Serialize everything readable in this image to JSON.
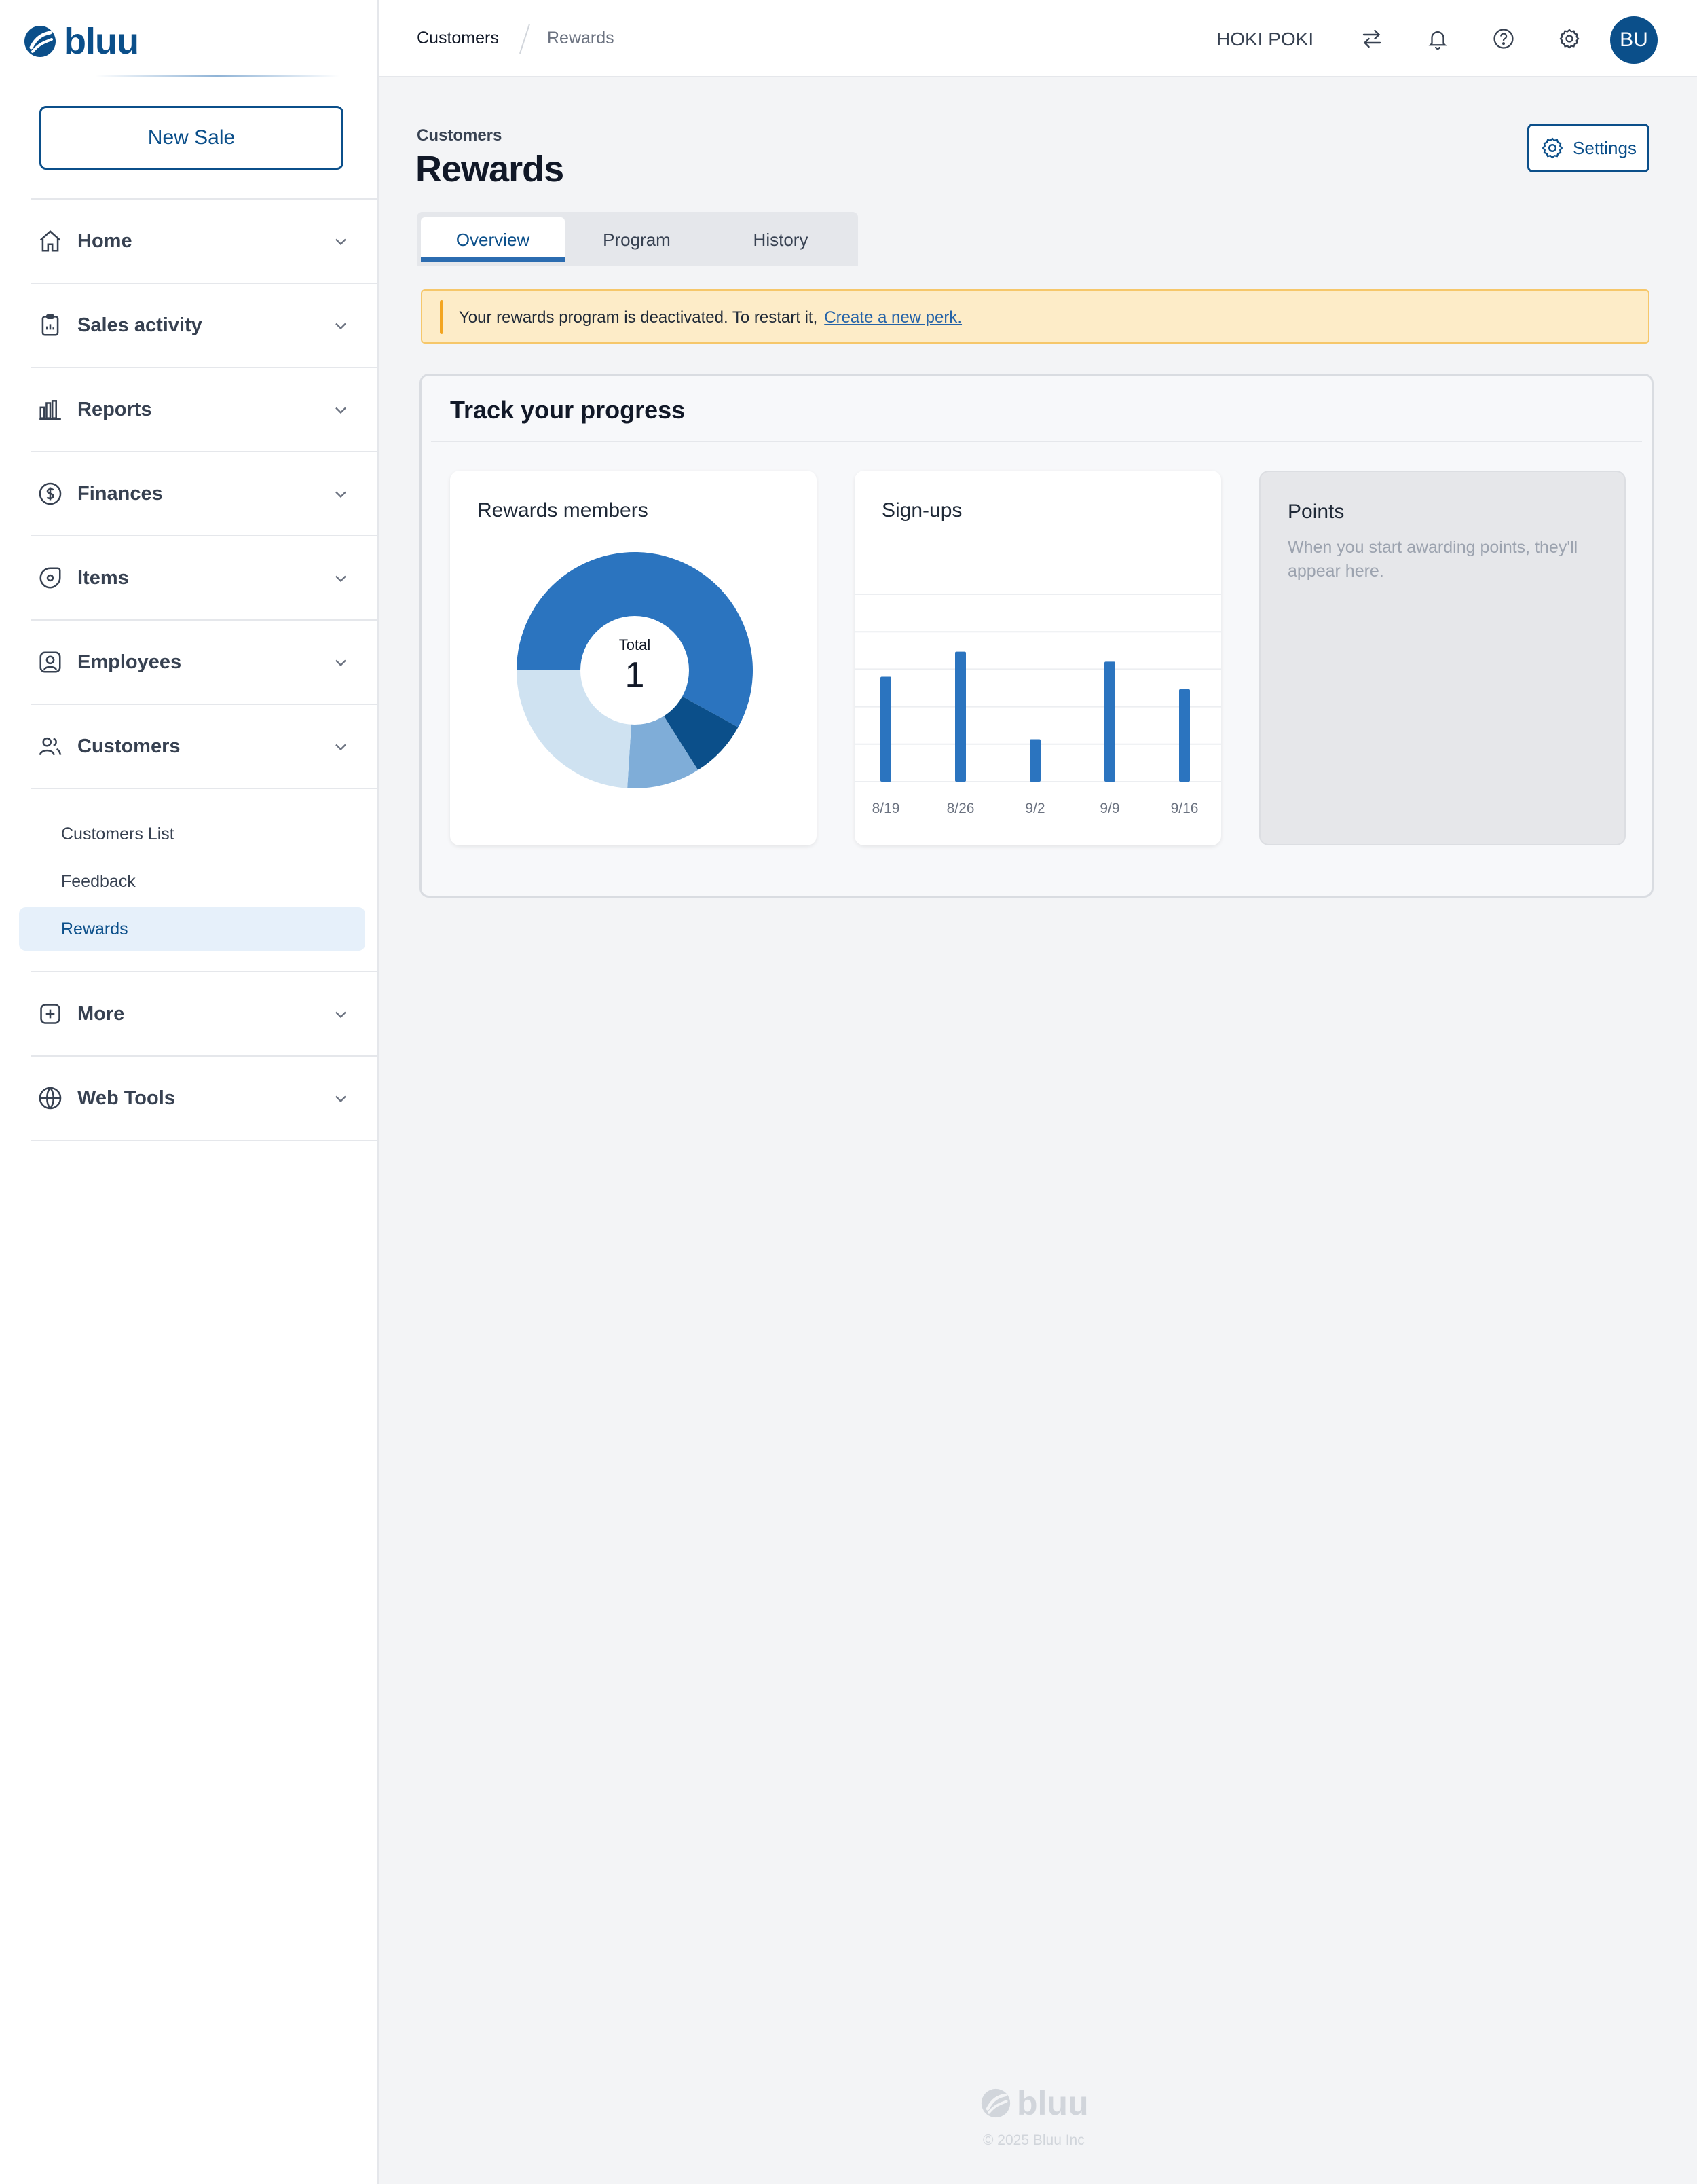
{
  "brand": {
    "name": "bluu",
    "accent": "#0b4f8a",
    "accent_light": "#2b6cb0"
  },
  "sidebar": {
    "new_sale_label": "New Sale",
    "items": [
      {
        "label": "Home",
        "icon": "home-icon"
      },
      {
        "label": "Sales activity",
        "icon": "clipboard-icon"
      },
      {
        "label": "Reports",
        "icon": "bar-chart-icon"
      },
      {
        "label": "Finances",
        "icon": "dollar-circle-icon"
      },
      {
        "label": "Items",
        "icon": "tag-icon"
      },
      {
        "label": "Employees",
        "icon": "id-badge-icon"
      },
      {
        "label": "Customers",
        "icon": "users-icon"
      },
      {
        "label": "More",
        "icon": "plus-square-icon"
      },
      {
        "label": "Web Tools",
        "icon": "globe-icon"
      }
    ],
    "customers_sub": [
      {
        "label": "Customers List",
        "active": false
      },
      {
        "label": "Feedback",
        "active": false
      },
      {
        "label": "Rewards",
        "active": true
      }
    ]
  },
  "topbar": {
    "breadcrumb": [
      "Customers",
      "Rewards"
    ],
    "store_name": "HOKI POKI",
    "icons": [
      "switch-arrows-icon",
      "bell-icon",
      "help-circle-icon",
      "gear-icon"
    ],
    "avatar_initials": "BU"
  },
  "page": {
    "eyebrow": "Customers",
    "title": "Rewards",
    "settings_label": "Settings",
    "tabs": [
      {
        "label": "Overview",
        "active": true
      },
      {
        "label": "Program",
        "active": false
      },
      {
        "label": "History",
        "active": false
      }
    ],
    "alert": {
      "text": "Your rewards program is deactivated. To restart it,",
      "link": "Create a new perk."
    },
    "progress": {
      "title": "Track your progress",
      "members": {
        "title": "Rewards members",
        "total_label": "Total",
        "total_value": "1"
      },
      "signups": {
        "title": "Sign-ups"
      },
      "points": {
        "title": "Points",
        "description": "When you start awarding points, they'll appear here."
      }
    }
  },
  "chart_data": [
    {
      "type": "pie",
      "title": "Rewards members",
      "values": [
        58,
        8,
        10,
        24
      ],
      "colors": [
        "#2b74bf",
        "#0b4f8a",
        "#7fadd8",
        "#cfe2f1"
      ]
    },
    {
      "type": "bar",
      "title": "Sign-ups",
      "categories": [
        "8/19",
        "8/26",
        "9/2",
        "9/9",
        "9/16"
      ],
      "values": [
        4.2,
        5.2,
        1.7,
        4.8,
        3.7
      ],
      "ylim": [
        0,
        7.5
      ],
      "grid": true,
      "color": "#2b74bf"
    }
  ],
  "footer": {
    "brand": "bluu",
    "copyright": "© 2025 Bluu Inc"
  }
}
